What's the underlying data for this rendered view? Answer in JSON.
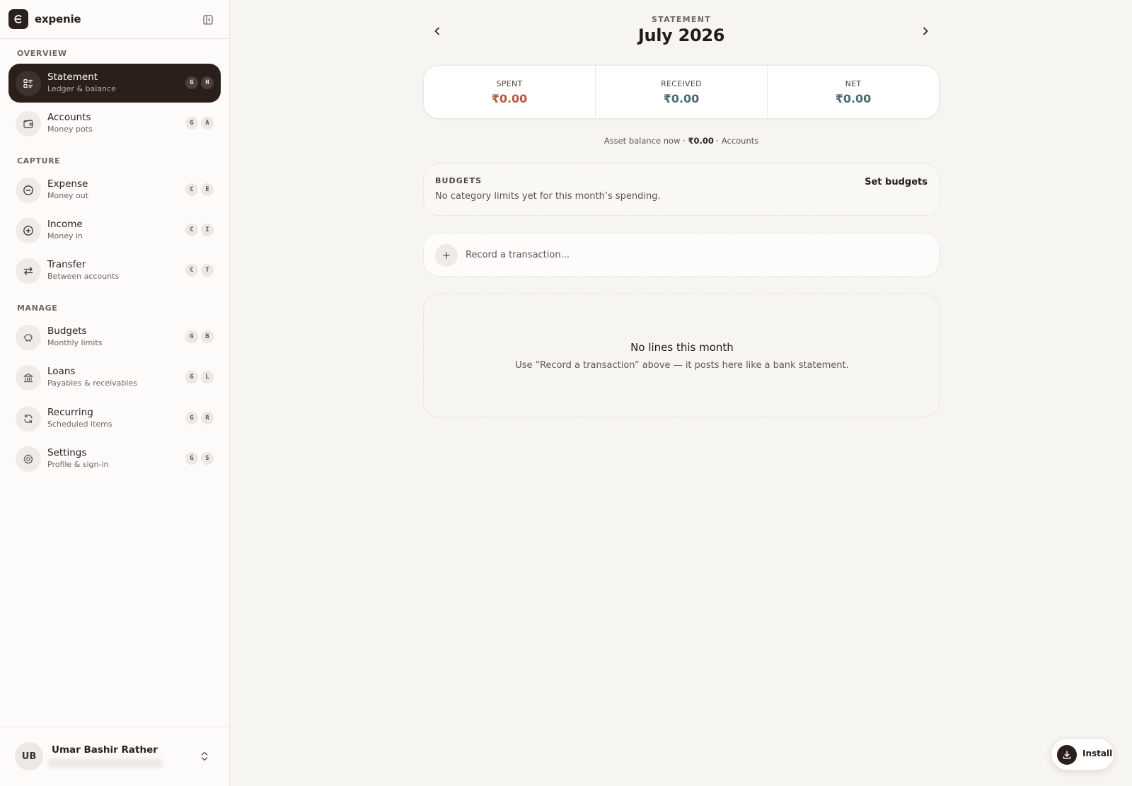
{
  "app": {
    "name": "expenie"
  },
  "sidebar": {
    "sections": {
      "overview": "OVERVIEW",
      "capture": "CAPTURE",
      "manage": "MANAGE"
    },
    "items": [
      {
        "title": "Statement",
        "subtitle": "Ledger & balance",
        "keys": [
          "G",
          "H"
        ],
        "icon": "statement-icon"
      },
      {
        "title": "Accounts",
        "subtitle": "Money pots",
        "keys": [
          "G",
          "A"
        ],
        "icon": "wallet-icon"
      },
      {
        "title": "Expense",
        "subtitle": "Money out",
        "keys": [
          "C",
          "E"
        ],
        "icon": "minus-circle-icon"
      },
      {
        "title": "Income",
        "subtitle": "Money in",
        "keys": [
          "C",
          "I"
        ],
        "icon": "plus-circle-icon"
      },
      {
        "title": "Transfer",
        "subtitle": "Between accounts",
        "keys": [
          "C",
          "T"
        ],
        "icon": "transfer-arrows-icon"
      },
      {
        "title": "Budgets",
        "subtitle": "Monthly limits",
        "keys": [
          "G",
          "B"
        ],
        "icon": "piggy-bank-icon"
      },
      {
        "title": "Loans",
        "subtitle": "Payables & receivables",
        "keys": [
          "G",
          "L"
        ],
        "icon": "bank-icon"
      },
      {
        "title": "Recurring",
        "subtitle": "Scheduled items",
        "keys": [
          "G",
          "R"
        ],
        "icon": "refresh-icon"
      },
      {
        "title": "Settings",
        "subtitle": "Profile & sign-in",
        "keys": [
          "G",
          "S"
        ],
        "icon": "gear-icon"
      }
    ],
    "active_item": "Statement",
    "user": {
      "initials": "UB",
      "name": "Umar Bashir Rather"
    }
  },
  "main": {
    "statement_label": "STATEMENT",
    "month_title": "July 2026",
    "summary": [
      {
        "label": "SPENT",
        "value": "₹0.00",
        "color": "#b8593f"
      },
      {
        "label": "RECEIVED",
        "value": "₹0.00",
        "color": "#4a6b73"
      },
      {
        "label": "NET",
        "value": "₹0.00",
        "color": "#4a6b73"
      }
    ],
    "asset_line": {
      "prefix": "Asset balance now · ",
      "amount": "₹0.00",
      "suffix": " · Accounts"
    },
    "budgets": {
      "title": "BUDGETS",
      "text": "No category limits yet for this month’s spending.",
      "action": "Set budgets"
    },
    "record": {
      "placeholder": "Record a transaction..."
    },
    "empty": {
      "title": "No lines this month",
      "subtitle": "Use “Record a transaction” above — it posts here like a bank statement."
    }
  },
  "install": {
    "label": "Install"
  },
  "colors": {
    "accent_dark": "#2a1f1b",
    "spent": "#b8593f",
    "received": "#4a6b73",
    "background": "#f7f5f2"
  }
}
